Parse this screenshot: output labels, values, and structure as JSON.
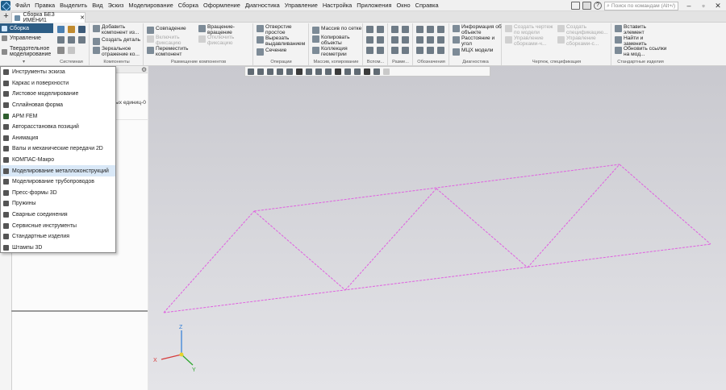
{
  "menubar": {
    "items": [
      "Файл",
      "Правка",
      "Выделить",
      "Вид",
      "Эскиз",
      "Моделирование",
      "Сборка",
      "Оформление",
      "Диагностика",
      "Управление",
      "Настройка",
      "Приложения",
      "Окно",
      "Справка"
    ],
    "search_placeholder": "Поиск по командам (Alt+/)"
  },
  "tabs": {
    "plus": "+",
    "document": "Сборка БЕЗ ИМЕНИ1",
    "close": "✕"
  },
  "modes": [
    {
      "label": "Сборка",
      "active": true
    },
    {
      "label": "Управление",
      "active": false
    },
    {
      "label": "Твердотельное моделирование",
      "active": false
    }
  ],
  "ribbon": {
    "system_label": "Системная",
    "components": {
      "label": "Компоненты",
      "buttons": [
        "Добавить компонент из...",
        "Создать деталь",
        "Зеркальное отражение ко..."
      ]
    },
    "placement": {
      "label": "Размещение компонентов",
      "buttons": [
        "Совпадение",
        "Включить фиксацию",
        "Переместить компонент",
        "Вращение-вращение",
        "Отключить фиксацию"
      ]
    },
    "operations": {
      "label": "Операции",
      "buttons": [
        "Отверстие простое",
        "Вырезать выдавливанием",
        "Сечение"
      ]
    },
    "array": {
      "label": "Массив, копирование",
      "buttons": [
        "Массив по сетке",
        "Копировать объекты",
        "Коллекция геометрии"
      ]
    },
    "aux_label": "Вспом...",
    "sketch_label": "Разме...",
    "notation_label": "Обозначения",
    "diagnostics": {
      "label": "Диагностика",
      "buttons": [
        "Информация об объекте",
        "Расстояние и угол",
        "МЦХ модели"
      ]
    },
    "drawing": {
      "label": "Чертеж, спецификация",
      "buttons": [
        "Создать чертеж по модели",
        "Управление сборками-ч...",
        "Создать спецификацию...",
        "Управление сборками-с..."
      ]
    },
    "standard": {
      "label": "Стандартные изделия",
      "buttons": [
        "Вставить элемент",
        "Найти и заменить",
        "Обновить ссылки на мод..."
      ]
    }
  },
  "panel": {
    "tree_text": "ых единиц-0",
    "gear": "⚙"
  },
  "dropdown": {
    "items": [
      {
        "label": "Инструменты эскиза",
        "icon": "sketch-tools-icon"
      },
      {
        "label": "Каркас и поверхности",
        "icon": "surface-icon"
      },
      {
        "label": "Листовое моделирование",
        "icon": "sheet-metal-icon"
      },
      {
        "label": "Сплайновая форма",
        "icon": "spline-icon"
      },
      {
        "label": "APM FEM",
        "icon": "apm-fem-icon"
      },
      {
        "label": "Авторасстановка позиций",
        "icon": "positions-icon"
      },
      {
        "label": "Анимация",
        "icon": "animation-icon"
      },
      {
        "label": "Валы и механические передачи 2D",
        "icon": "shafts-icon"
      },
      {
        "label": "КОМПАС-Макро",
        "icon": "macro-icon"
      },
      {
        "label": "Моделирование металлоконструкций",
        "icon": "metal-structures-icon",
        "highlighted": true
      },
      {
        "label": "Моделирование трубопроводов",
        "icon": "pipeline-icon"
      },
      {
        "label": "Пресс-формы 3D",
        "icon": "molds-icon"
      },
      {
        "label": "Пружины",
        "icon": "springs-icon"
      },
      {
        "label": "Сварные соединения",
        "icon": "welds-icon"
      },
      {
        "label": "Сервисные инструменты",
        "icon": "service-tools-icon"
      },
      {
        "label": "Стандартные изделия",
        "icon": "standard-parts-icon"
      },
      {
        "label": "Штампы 3D",
        "icon": "stamps-icon"
      }
    ]
  },
  "viewport": {
    "axis_x": "X",
    "axis_y": "Y",
    "axis_z": "Z",
    "truss_color": "#e060e0",
    "truss_nodes_3d": "sketch"
  },
  "colors": {
    "accent": "#2d5d85",
    "highlight": "#d9e8f7"
  }
}
